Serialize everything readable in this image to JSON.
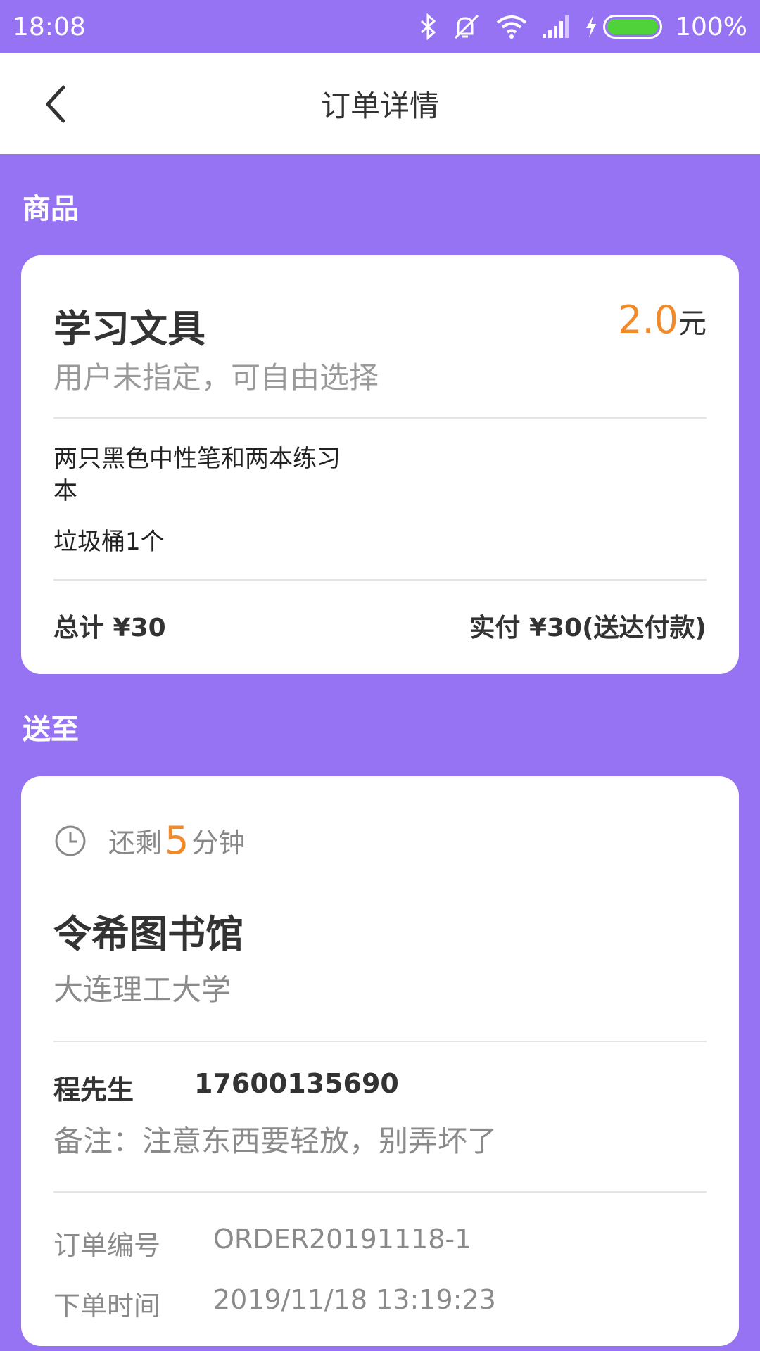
{
  "status_bar": {
    "time": "18:08",
    "battery_percent": "100%",
    "icons": [
      "bluetooth-icon",
      "mute-icon",
      "wifi-icon",
      "signal-icon",
      "charging-icon",
      "battery-icon"
    ]
  },
  "nav": {
    "title": "订单详情",
    "back_icon": "chevron-left-icon"
  },
  "goods_section": {
    "label": "商品",
    "title": "学习文具",
    "price_value": "2.0",
    "price_unit": "元",
    "subtitle": "用户未指定，可自由选择",
    "items": [
      "两只黑色中性笔和两本练习",
      "本",
      "垃圾桶1个"
    ],
    "total_label": "总计 ¥30",
    "paid_label": "实付 ¥30(送达付款)"
  },
  "delivery_section": {
    "label": "送至",
    "remaining_prefix": "还剩",
    "remaining_value": "5",
    "remaining_suffix": "分钟",
    "place_name": "令希图书馆",
    "place_sub": "大连理工大学",
    "contact_name": "程先生",
    "contact_phone": "17600135690",
    "remark": "备注：注意东西要轻放，别弄坏了",
    "order_no_label": "订单编号",
    "order_no_value": "ORDER20191118-1",
    "order_time_label": "下单时间",
    "order_time_value": "2019/11/18 13:19:23"
  },
  "colors": {
    "background": "#9673f2",
    "accent_orange": "#f08a2a",
    "battery_green": "#4fd23a"
  }
}
